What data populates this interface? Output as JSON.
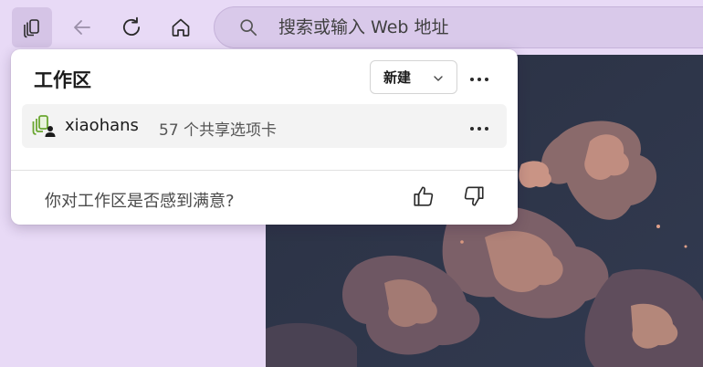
{
  "toolbar": {
    "workspaces_icon": "workspaces-icon",
    "back_icon": "back-arrow-icon",
    "refresh_icon": "refresh-icon",
    "home_icon": "home-icon"
  },
  "address_bar": {
    "placeholder": "搜索或输入 Web 地址",
    "icon": "search-icon"
  },
  "flyout": {
    "title": "工作区",
    "new_button_label": "新建",
    "more_icon": "more-horizontal-icon",
    "workspaces": [
      {
        "name": "xiaohans",
        "meta": "57 个共享选项卡",
        "icon": "shared-workspace-icon"
      }
    ],
    "feedback": {
      "question": "你对工作区是否感到满意?",
      "like_icon": "thumbs-up-icon",
      "dislike_icon": "thumbs-down-icon"
    }
  },
  "colors": {
    "window_bg": "#e8daf6",
    "address_bg": "#d9c9ea",
    "flyout_bg": "#ffffff",
    "item_bg": "#f3f3f3",
    "workspace_icon_green": "#6aa631"
  }
}
